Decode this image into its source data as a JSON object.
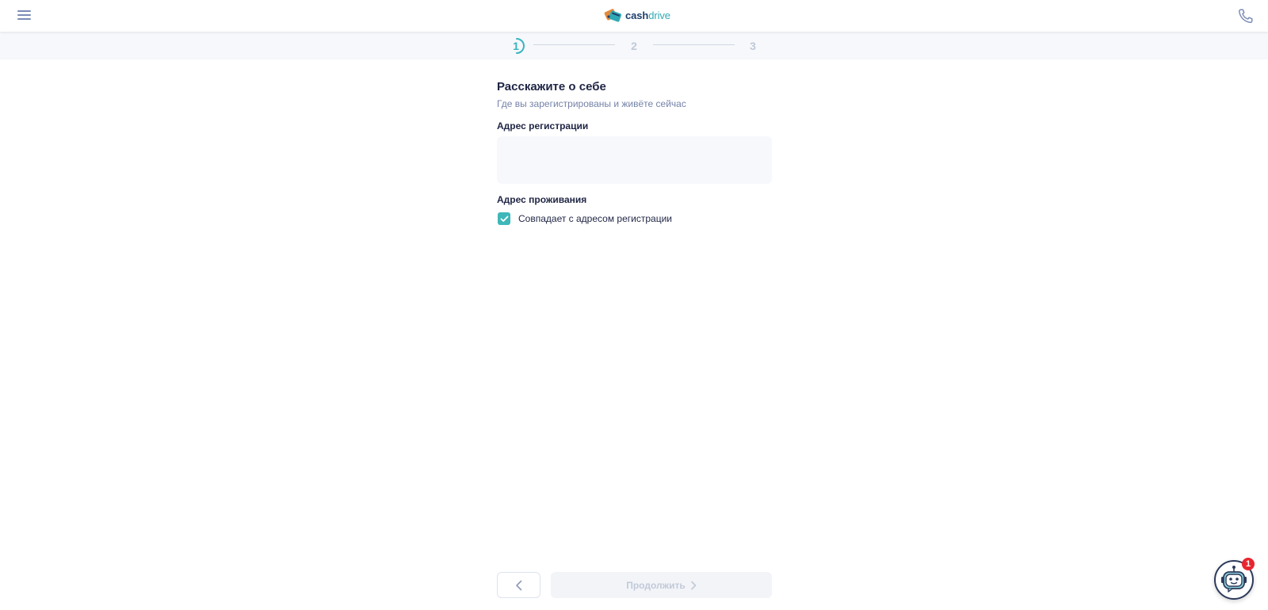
{
  "header": {
    "menu_icon": "hamburger-menu-icon",
    "logo": {
      "part1": "cash",
      "part2": "drive"
    },
    "phone_icon": "phone-icon"
  },
  "stepper": {
    "steps": [
      "1",
      "2",
      "3"
    ],
    "active_step": 1,
    "colors": {
      "active": "#38b5c0",
      "inactive": "#c0c9d8"
    }
  },
  "form": {
    "title": "Расскажите о себе",
    "subtitle": "Где вы зарегистрированы и живёте сейчас",
    "registration_label": "Адрес регистрации",
    "registration_value": "",
    "residence_label": "Адрес проживания",
    "same_address_checkbox": {
      "label": "Совпадает с адресом регистрации",
      "checked": true
    }
  },
  "footer": {
    "back_icon": "chevron-left-icon",
    "continue_label": "Продолжить",
    "continue_icon": "chevron-right-icon"
  },
  "chat": {
    "icon": "robot-chat-icon",
    "badge_count": "1"
  },
  "colors": {
    "accent": "#3fb7b9",
    "text": "#1f2544",
    "muted": "#7583a8",
    "badge": "#e8252f"
  }
}
